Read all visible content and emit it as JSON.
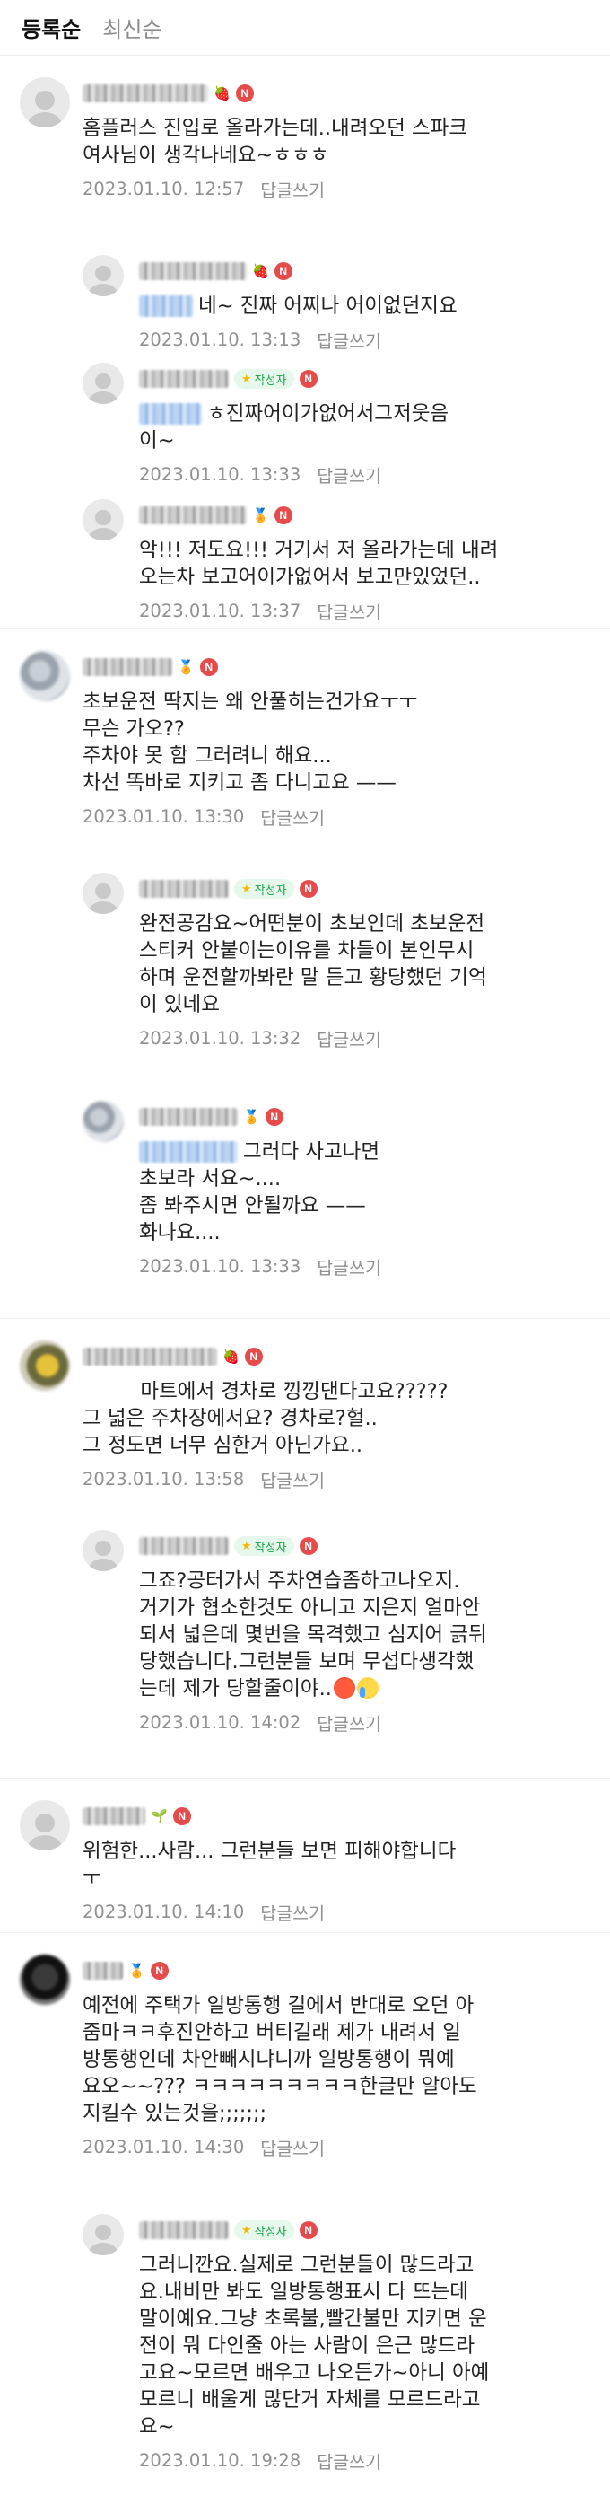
{
  "sort_tabs": [
    "등록순",
    "최신순"
  ],
  "reply_label": "답글쓰기",
  "writer_label": "작성자",
  "new_badge": "N",
  "comments": [
    {
      "id": "c1",
      "level": "top",
      "avatar": "default",
      "nick": "",
      "nick_w": 140,
      "icon": "🍓",
      "body": "홈플러스 진입로 올라가는데..내려오던 스파크\n여사님이 생각나네요~ㅎㅎㅎ",
      "date": "2023.01.10. 12:57"
    },
    {
      "id": "c1r1",
      "level": "reply",
      "avatar": "default",
      "nick": "",
      "nick_w": 120,
      "icon": "🍓",
      "mention_w": 60,
      "body": "네~ 진짜 어찌나 어이없던지요",
      "date": "2023.01.10. 13:13"
    },
    {
      "id": "c1r2",
      "level": "reply",
      "avatar": "default",
      "nick": "",
      "nick_w": 100,
      "writer": true,
      "mention_w": 70,
      "body": "ㅎ진짜어이가없어서그저웃음\n이~",
      "date": "2023.01.10. 13:33"
    },
    {
      "id": "c1r3",
      "level": "reply",
      "avatar": "default",
      "nick": "",
      "nick_w": 120,
      "icon": "🏅",
      "body": "악!!! 저도요!!! 거기서 저 올라가는데 내려\n오는차 보고어이가없어서 보고만있었던..",
      "date": "2023.01.10. 13:37"
    },
    {
      "id": "c2",
      "level": "top",
      "avatar": "gray",
      "nick": "",
      "nick_w": 100,
      "icon": "🏅",
      "body": "초보운전 딱지는 왜 안풀히는건가요ㅜㅜ\n무슨 가오??\n주차야 못 함 그러려니 해요...\n차선 똑바로 지키고 좀 다니고요 ——",
      "date": "2023.01.10. 13:30"
    },
    {
      "id": "c2r1",
      "level": "reply",
      "avatar": "default",
      "nick": "",
      "nick_w": 100,
      "writer": true,
      "body": "완전공감요~어떤분이 초보인데 초보운전\n스티커 안붙이는이유를 차들이 본인무시\n하며 운전할까봐란 말 듣고 황당했던 기억\n이 있네요",
      "date": "2023.01.10. 13:32"
    },
    {
      "id": "c2r2",
      "level": "reply",
      "avatar": "gray",
      "nick": "",
      "nick_w": 110,
      "icon": "🏅",
      "mention_w": 110,
      "body": "그러다 사고나면\n초보라 서요~....\n좀 봐주시면 안될까요 ——\n화나요....",
      "date": "2023.01.10. 13:33"
    },
    {
      "id": "c3",
      "level": "top",
      "avatar": "yellow",
      "nick": "",
      "nick_w": 150,
      "icon": "🍓",
      "body": "         마트에서 경차로 낑낑댄다고요?????\n그 넓은 주차장에서요? 경차로?헐..\n그 정도면 너무 심한거 아닌가요..",
      "date": "2023.01.10. 13:58"
    },
    {
      "id": "c3r1",
      "level": "reply",
      "avatar": "default",
      "nick": "",
      "nick_w": 100,
      "writer": true,
      "body": "그죠?공터가서 주차연습좀하고나오지.\n거기가 협소한것도 아니고 지은지 얼마안\n되서 넓은데 몇번을 목격했고 심지어 긁뒤\n당했습니다.그런분들 보며 무섭다생각했\n는데 제가 당할줄이야..",
      "emoji": true,
      "date": "2023.01.10. 14:02"
    },
    {
      "id": "c4",
      "level": "top",
      "avatar": "default",
      "nick": "",
      "nick_w": 70,
      "icon": "🌱",
      "body": "위험한...사람... 그런분들 보면 피해야합니다\nㅜ",
      "date": "2023.01.10. 14:10"
    },
    {
      "id": "c5",
      "level": "top",
      "avatar": "dark",
      "nick": "",
      "nick_w": 45,
      "icon": "🏅",
      "body": "예전에 주택가 일방통행 길에서 반대로 오던 아\n줌마ㅋㅋ후진안하고 버티길래 제가 내려서 일\n방통행인데 차안빼시냐니까 일방통행이 뭐예\n요오~~??? ㅋㅋㅋㅋㅋㅋㅋㅋㅋ한글만 알아도\n지킬수 있는것을;;;;;;;",
      "date": "2023.01.10. 14:30"
    },
    {
      "id": "c5r1",
      "level": "reply",
      "avatar": "default",
      "nick": "",
      "nick_w": 100,
      "writer": true,
      "body": "그러니깐요.실제로 그런분들이 많드라고\n요.내비만 봐도 일방통행표시 다 뜨는데\n말이예요.그냥 초록불,빨간불만 지키면 운\n전이 뭐 다인줄 아는 사람이 은근 많드라\n고요~모르면 배우고 나오든가~아니 아예\n모르니 배울게 많단거 자체를 모르드라고\n요~",
      "date": "2023.01.10. 19:28"
    }
  ]
}
